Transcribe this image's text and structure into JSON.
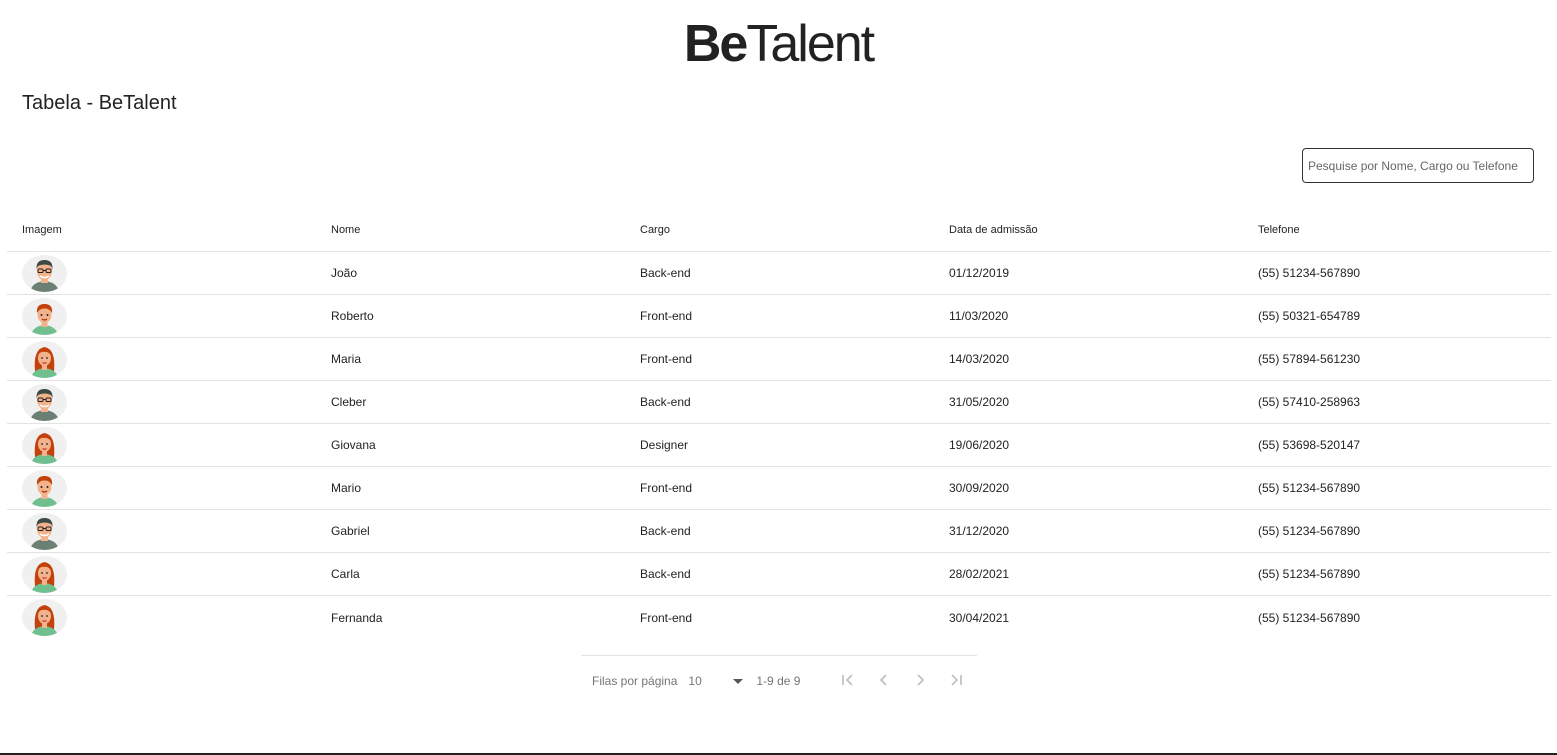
{
  "logo": {
    "part1": "Be",
    "part2": "Talent"
  },
  "page_title": "Tabela - BeTalent",
  "search": {
    "placeholder": "Pesquise por Nome, Cargo ou Telefone",
    "value": ""
  },
  "table": {
    "headers": [
      "Imagem",
      "Nome",
      "Cargo",
      "Data de admissão",
      "Telefone"
    ],
    "rows": [
      {
        "avatar": "man-glasses-avatar",
        "name": "João",
        "role": "Back-end",
        "admission": "01/12/2019",
        "phone": "(55) 51234-567890"
      },
      {
        "avatar": "young-man-avatar",
        "name": "Roberto",
        "role": "Front-end",
        "admission": "11/03/2020",
        "phone": "(55) 50321-654789"
      },
      {
        "avatar": "woman-redhead-avatar",
        "name": "Maria",
        "role": "Front-end",
        "admission": "14/03/2020",
        "phone": "(55) 57894-561230"
      },
      {
        "avatar": "man-glasses-avatar",
        "name": "Cleber",
        "role": "Back-end",
        "admission": "31/05/2020",
        "phone": "(55) 57410-258963"
      },
      {
        "avatar": "woman-redhead-avatar",
        "name": "Giovana",
        "role": "Designer",
        "admission": "19/06/2020",
        "phone": "(55) 53698-520147"
      },
      {
        "avatar": "young-man-avatar",
        "name": "Mario",
        "role": "Front-end",
        "admission": "30/09/2020",
        "phone": "(55) 51234-567890"
      },
      {
        "avatar": "man-glasses-avatar",
        "name": "Gabriel",
        "role": "Back-end",
        "admission": "31/12/2020",
        "phone": "(55) 51234-567890"
      },
      {
        "avatar": "woman-redhead-avatar",
        "name": "Carla",
        "role": "Back-end",
        "admission": "28/02/2021",
        "phone": "(55) 51234-567890"
      },
      {
        "avatar": "woman-redhead-avatar",
        "name": "Fernanda",
        "role": "Front-end",
        "admission": "30/04/2021",
        "phone": "(55) 51234-567890"
      }
    ]
  },
  "pagination": {
    "rows_per_page_label": "Filas por página",
    "rows_per_page": "10",
    "range": "1-9 de 9",
    "icons": [
      "first-page-icon",
      "previous-page-icon",
      "next-page-icon",
      "last-page-icon"
    ]
  },
  "colors": {
    "text": "#222222",
    "muted": "#757575",
    "divider": "#e3e3e3",
    "avatar_bg": "#f0f0f0",
    "shirt": "#6fbf8f",
    "hair_red": "#c2410c",
    "skin": "#f2b38c"
  }
}
